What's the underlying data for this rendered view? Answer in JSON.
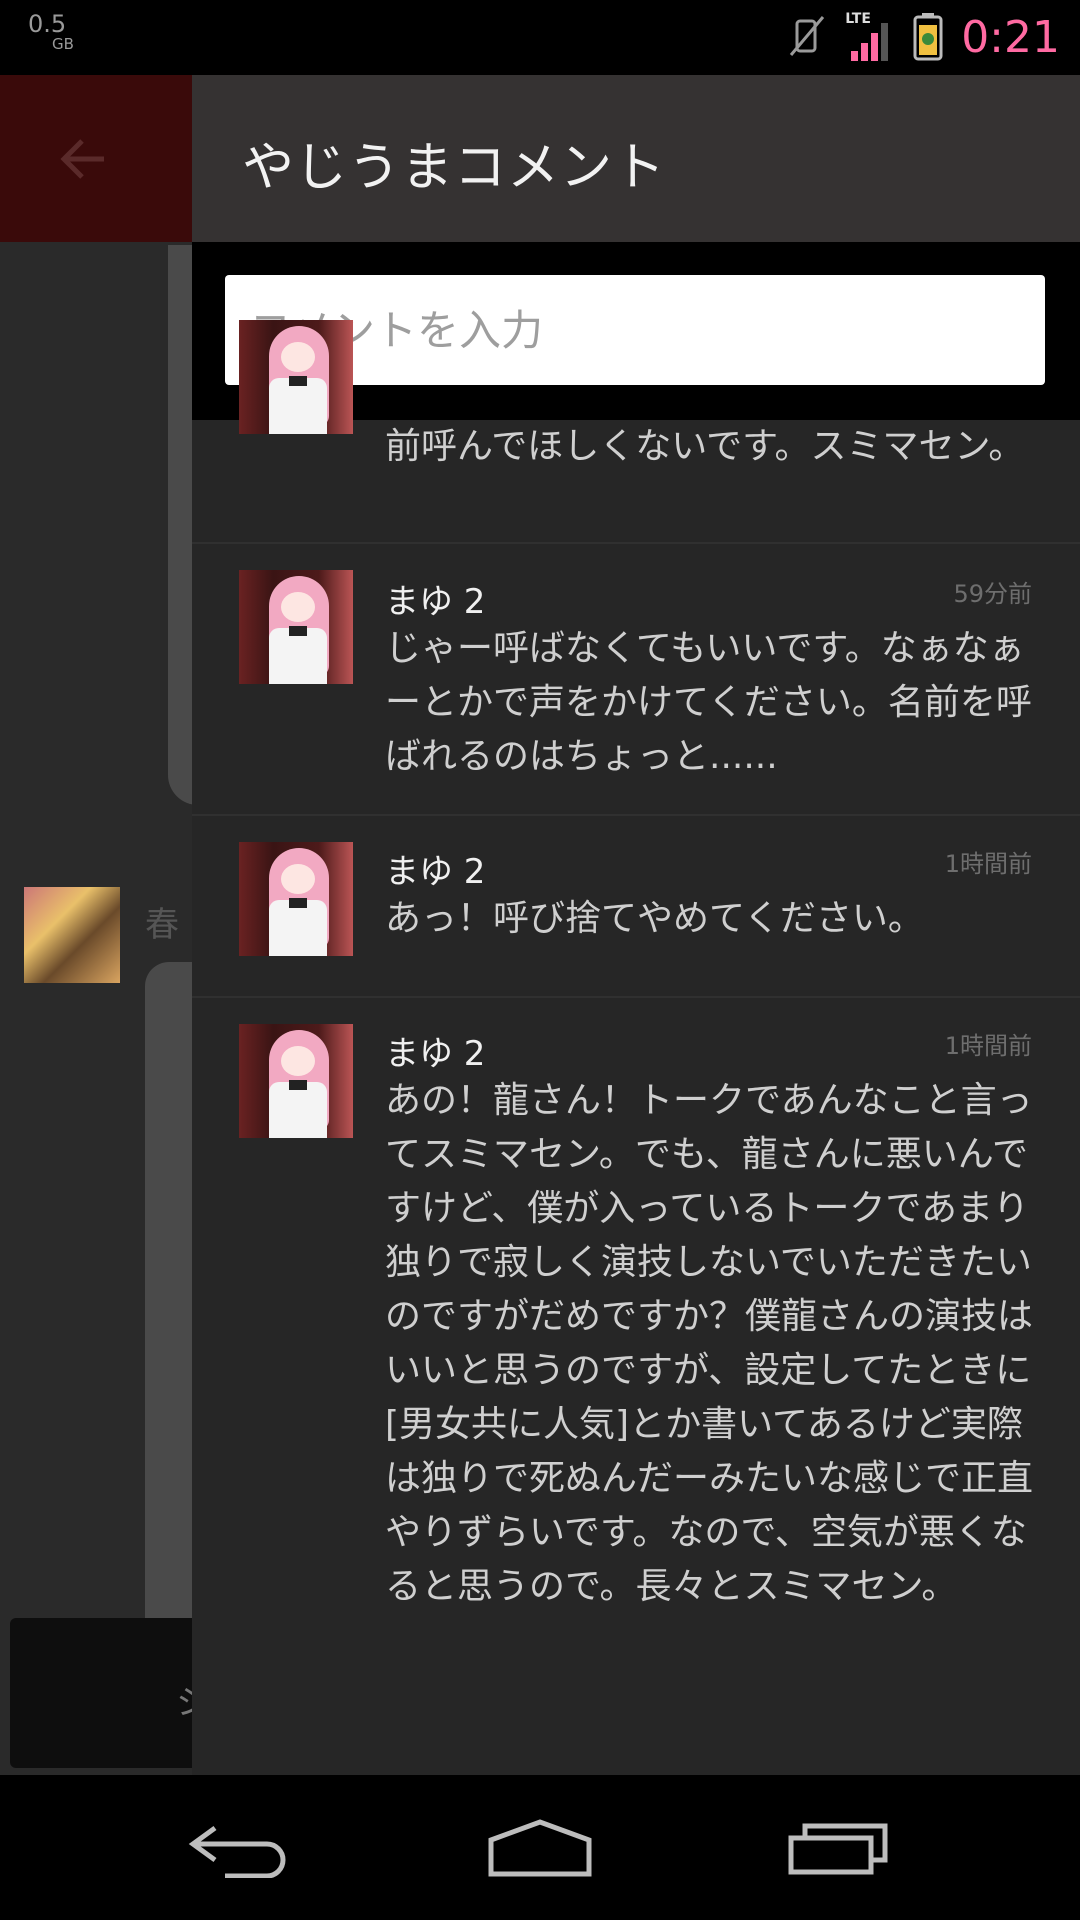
{
  "status_bar": {
    "memory_value": "0.5",
    "memory_unit": "GB",
    "network_label": "LTE",
    "time": "0:21",
    "icons": [
      "vibrate-off-icon",
      "signal-icon",
      "battery-icon"
    ],
    "time_color": "#ff6aa2"
  },
  "background_app": {
    "back_icon": "arrow-left-icon",
    "partial_text": "春",
    "partial_input_char": "シ",
    "toolbar_color": "#3a0a0a"
  },
  "drawer": {
    "title": "やじうまコメント",
    "search": {
      "placeholder": "コメントを入力",
      "value": ""
    },
    "comments": [
      {
        "name": "",
        "time": "",
        "body": "前呼んでほしくないです。スミマセン。"
      },
      {
        "name": "まゆ 2",
        "time": "59分前",
        "body": "じゃー呼ばなくてもいいです。なぁなぁーとかで声をかけてください。名前を呼ばれるのはちょっと......"
      },
      {
        "name": "まゆ 2",
        "time": "1時間前",
        "body": "あっ！呼び捨てやめてください。"
      },
      {
        "name": "まゆ 2",
        "time": "1時間前",
        "body": "あの！龍さん！トークであんなこと言ってスミマセン。でも、龍さんに悪いんですけど、僕が入っているトークであまり独りで寂しく演技しないでいただきたいのですがだめですか？僕龍さんの演技はいいと思うのですが、設定してたときに[男女共に人気]とか書いてあるけど実際は独りで死ぬんだーみたいな感じで正直やりずらいです。なので、空気が悪くなると思うので。長々とスミマセン。"
      }
    ]
  },
  "nav_bar": {
    "icons": [
      "back-icon",
      "home-icon",
      "recents-icon"
    ]
  }
}
